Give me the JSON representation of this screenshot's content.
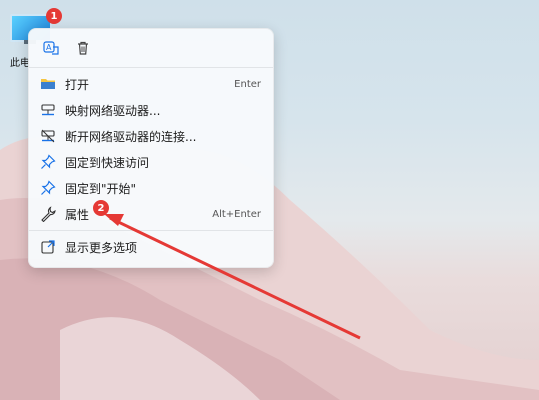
{
  "desktop": {
    "icon_label": "此电脑",
    "badge1": "1",
    "badge2": "2"
  },
  "menu": {
    "top_icons": [
      "translate-icon",
      "trash-icon"
    ],
    "items": [
      {
        "label": "打开",
        "shortcut": "Enter",
        "icon": "folder-icon"
      },
      {
        "label": "映射网络驱动器...",
        "shortcut": "",
        "icon": "network-drive-icon"
      },
      {
        "label": "断开网络驱动器的连接...",
        "shortcut": "",
        "icon": "disconnect-drive-icon"
      },
      {
        "label": "固定到快速访问",
        "shortcut": "",
        "icon": "pin-icon"
      },
      {
        "label": "固定到\"开始\"",
        "shortcut": "",
        "icon": "pin-icon"
      },
      {
        "label": "属性",
        "shortcut": "Alt+Enter",
        "icon": "wrench-icon"
      }
    ],
    "more": {
      "label": "显示更多选项",
      "icon": "more-options-icon"
    }
  },
  "colors": {
    "accent": "#e53935",
    "arrow": "#e53935",
    "icon_blue": "#1a73e8"
  }
}
